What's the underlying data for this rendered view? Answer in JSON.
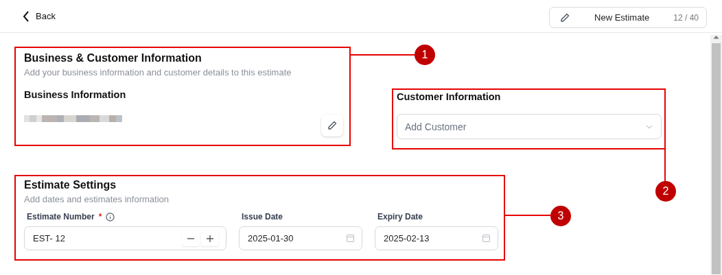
{
  "header": {
    "back": "Back",
    "estimate_button": {
      "label": "New Estimate",
      "count": "12 / 40"
    }
  },
  "business_customer": {
    "title": "Business & Customer Information",
    "subtitle": "Add your business information and customer details to this estimate",
    "business_label": "Business Information"
  },
  "customer": {
    "title": "Customer Information",
    "placeholder": "Add Customer"
  },
  "estimate_settings": {
    "title": "Estimate Settings",
    "subtitle": "Add dates and estimates information",
    "fields": [
      {
        "kind": "stepper",
        "label": "Estimate Number",
        "required_mark": "*",
        "value": "EST- 12"
      },
      {
        "kind": "date",
        "label": "Issue Date",
        "value": "2025-01-30"
      },
      {
        "kind": "date",
        "label": "Expiry Date",
        "value": "2025-02-13"
      }
    ]
  },
  "callouts": [
    {
      "number": "1"
    },
    {
      "number": "2"
    },
    {
      "number": "3"
    }
  ]
}
